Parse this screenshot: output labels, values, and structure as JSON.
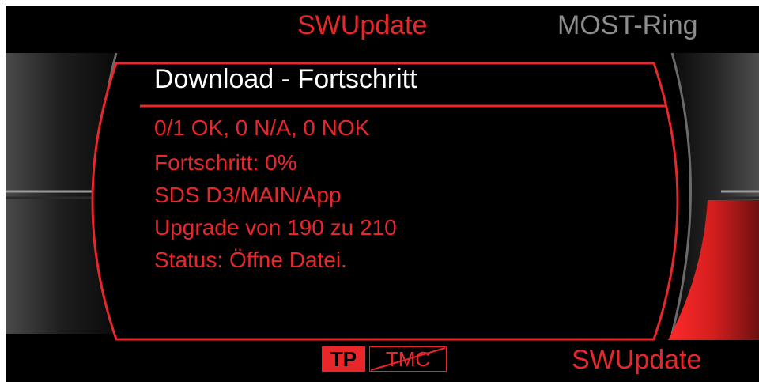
{
  "header": {
    "active_label": "SWUpdate",
    "inactive_label": "MOST-Ring"
  },
  "panel": {
    "title": "Download - Fortschritt",
    "lines": [
      "0/1 OK, 0 N/A, 0 NOK",
      "Fortschritt: 0%",
      "SDS D3/MAIN/App",
      "Upgrade von 190 zu 210",
      "Status: Öffne Datei."
    ]
  },
  "footer": {
    "tp_label": "TP",
    "tmc_label": "TMC",
    "softkey_label": "SWUpdate"
  },
  "colors": {
    "accent": "#e8272b",
    "inactive": "#8d8d8d",
    "background": "#000000",
    "title": "#ffffff"
  },
  "icons": {
    "left_control": "left-rotary-control-graphic",
    "right_control": "right-rotary-control-graphic",
    "tmc_disabled": "strike-through-icon"
  }
}
